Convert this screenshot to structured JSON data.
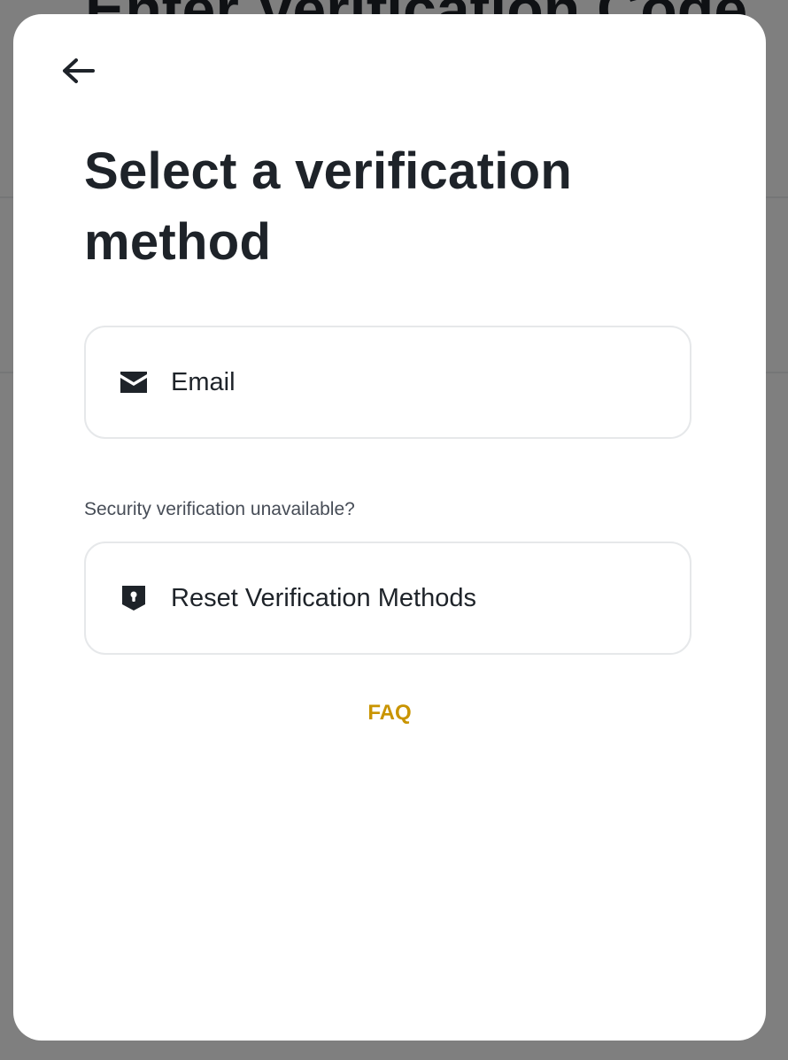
{
  "background": {
    "title": "Enter Verification Code"
  },
  "modal": {
    "back_icon": "arrow-left-icon",
    "title": "Select a verification method",
    "options": [
      {
        "label": "Email",
        "icon": "envelope-icon"
      },
      {
        "label": "Reset Verification Methods",
        "icon": "shield-lock-icon"
      }
    ],
    "hint": "Security verification unavailable?",
    "faq_label": "FAQ"
  },
  "colors": {
    "text_primary": "#1e2329",
    "text_secondary": "#474d57",
    "accent": "#c99400",
    "border": "#e6e8ea"
  }
}
